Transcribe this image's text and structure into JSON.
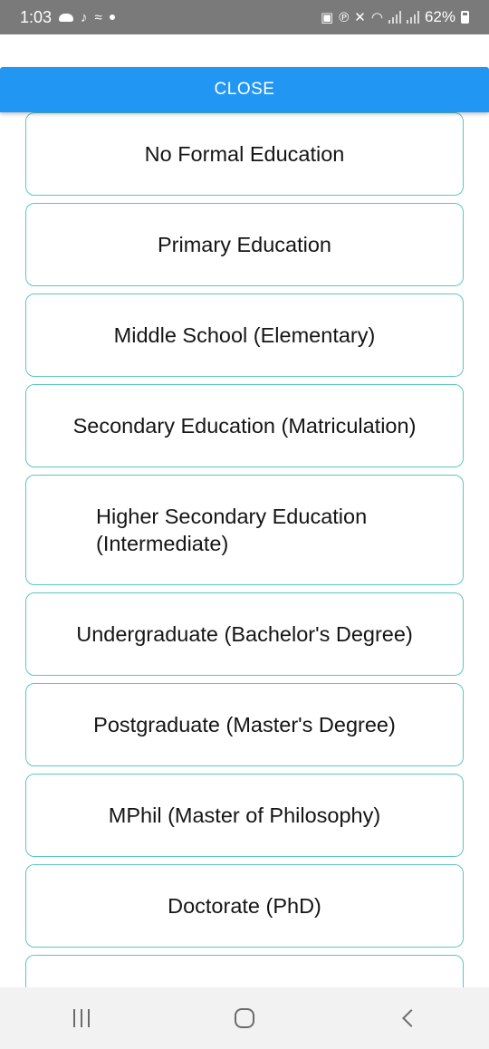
{
  "status_bar": {
    "time": "1:03",
    "battery": "62%",
    "left_icons": [
      "cloud-icon",
      "tiktok-icon",
      "voicemail-icon",
      "dot-icon"
    ],
    "right_icons": [
      "bag-icon",
      "parking-icon",
      "mute-icon",
      "wifi-icon",
      "signal-icon",
      "signal-icon",
      "battery-icon"
    ]
  },
  "close_button": {
    "label": "CLOSE"
  },
  "colors": {
    "accent": "#2196f3",
    "option_border": "#5cc6c0",
    "status_bar": "#7a7a7a"
  },
  "options": [
    {
      "label": "No Formal Education"
    },
    {
      "label": "Primary Education"
    },
    {
      "label": "Middle School (Elementary)"
    },
    {
      "label": "Secondary Education (Matriculation)"
    },
    {
      "label": "Higher Secondary Education (Intermediate)"
    },
    {
      "label": "Undergraduate (Bachelor's Degree)"
    },
    {
      "label": "Postgraduate (Master's Degree)"
    },
    {
      "label": "MPhil (Master of Philosophy)"
    },
    {
      "label": "Doctorate (PhD)"
    }
  ],
  "nav_bar": {
    "buttons": [
      "recents-icon",
      "home-icon",
      "back-icon"
    ]
  }
}
